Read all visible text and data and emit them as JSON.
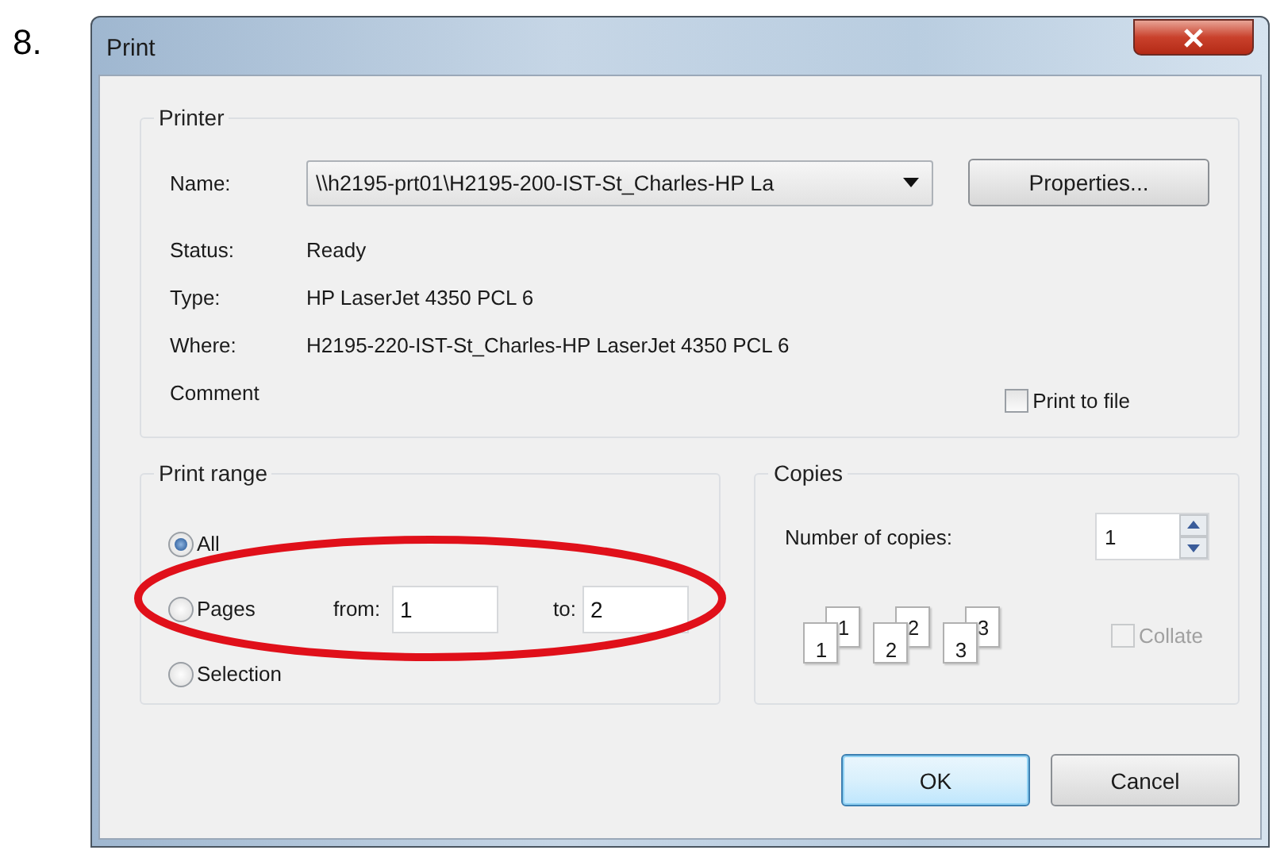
{
  "list_marker": "8.",
  "window": {
    "title": "Print"
  },
  "printer": {
    "legend": "Printer",
    "name_label": "Name:",
    "name_value": "\\\\h2195-prt01\\H2195-200-IST-St_Charles-HP La",
    "properties_button": "Properties...",
    "info": [
      {
        "label": "Status:",
        "value": "Ready"
      },
      {
        "label": "Type:",
        "value": "HP LaserJet 4350 PCL 6"
      },
      {
        "label": "Where:",
        "value": "H2195-220-IST-St_Charles-HP LaserJet 4350 PCL 6"
      },
      {
        "label": "Comment"
      }
    ],
    "print_to_file": {
      "label": "Print to file",
      "checked": false
    }
  },
  "print_range": {
    "legend": "Print range",
    "options": [
      {
        "label": "All",
        "selected": true
      },
      {
        "label": "Pages",
        "selected": false,
        "from_label": "from:",
        "from_value": "1",
        "to_label": "to:",
        "to_value": "2"
      },
      {
        "label": "Selection",
        "selected": false
      }
    ]
  },
  "copies": {
    "legend": "Copies",
    "number_label": "Number of copies:",
    "number_value": "1",
    "stacks": [
      {
        "front": "1",
        "back": "1"
      },
      {
        "front": "2",
        "back": "2"
      },
      {
        "front": "3",
        "back": "3"
      }
    ],
    "collate": {
      "label": "Collate",
      "checked": false,
      "disabled": true
    }
  },
  "annotation": {
    "kind": "ellipse"
  },
  "buttons": [
    {
      "label": "OK",
      "default": true
    },
    {
      "label": "Cancel",
      "default": false
    }
  ]
}
